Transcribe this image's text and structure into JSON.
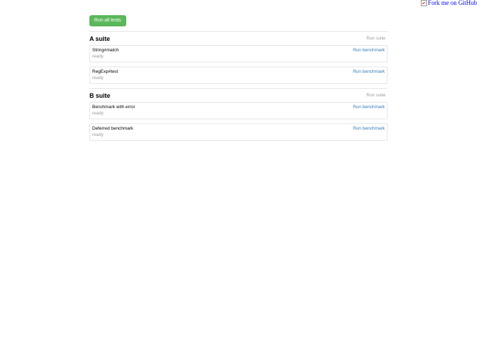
{
  "fork": {
    "alt_text": "Fork me on GitHub"
  },
  "toolbar": {
    "run_all_label": "Run all tests"
  },
  "suites": [
    {
      "title": "A suite",
      "run_label": "Run suite",
      "benchmarks": [
        {
          "name": "String#match",
          "status": "ready",
          "run_label": "Run benchmark"
        },
        {
          "name": "RegExp#test",
          "status": "ready",
          "run_label": "Run benchmark"
        }
      ]
    },
    {
      "title": "B suite",
      "run_label": "Run suite",
      "benchmarks": [
        {
          "name": "Benchmark with error",
          "status": "ready",
          "run_label": "Run benchmark"
        },
        {
          "name": "Deferred benchmark",
          "status": "ready",
          "run_label": "Run benchmark"
        }
      ]
    }
  ],
  "colors": {
    "primary_button": "#5cb85c",
    "link": "#337ab7",
    "muted": "#999999",
    "border": "#e5e5e5"
  }
}
